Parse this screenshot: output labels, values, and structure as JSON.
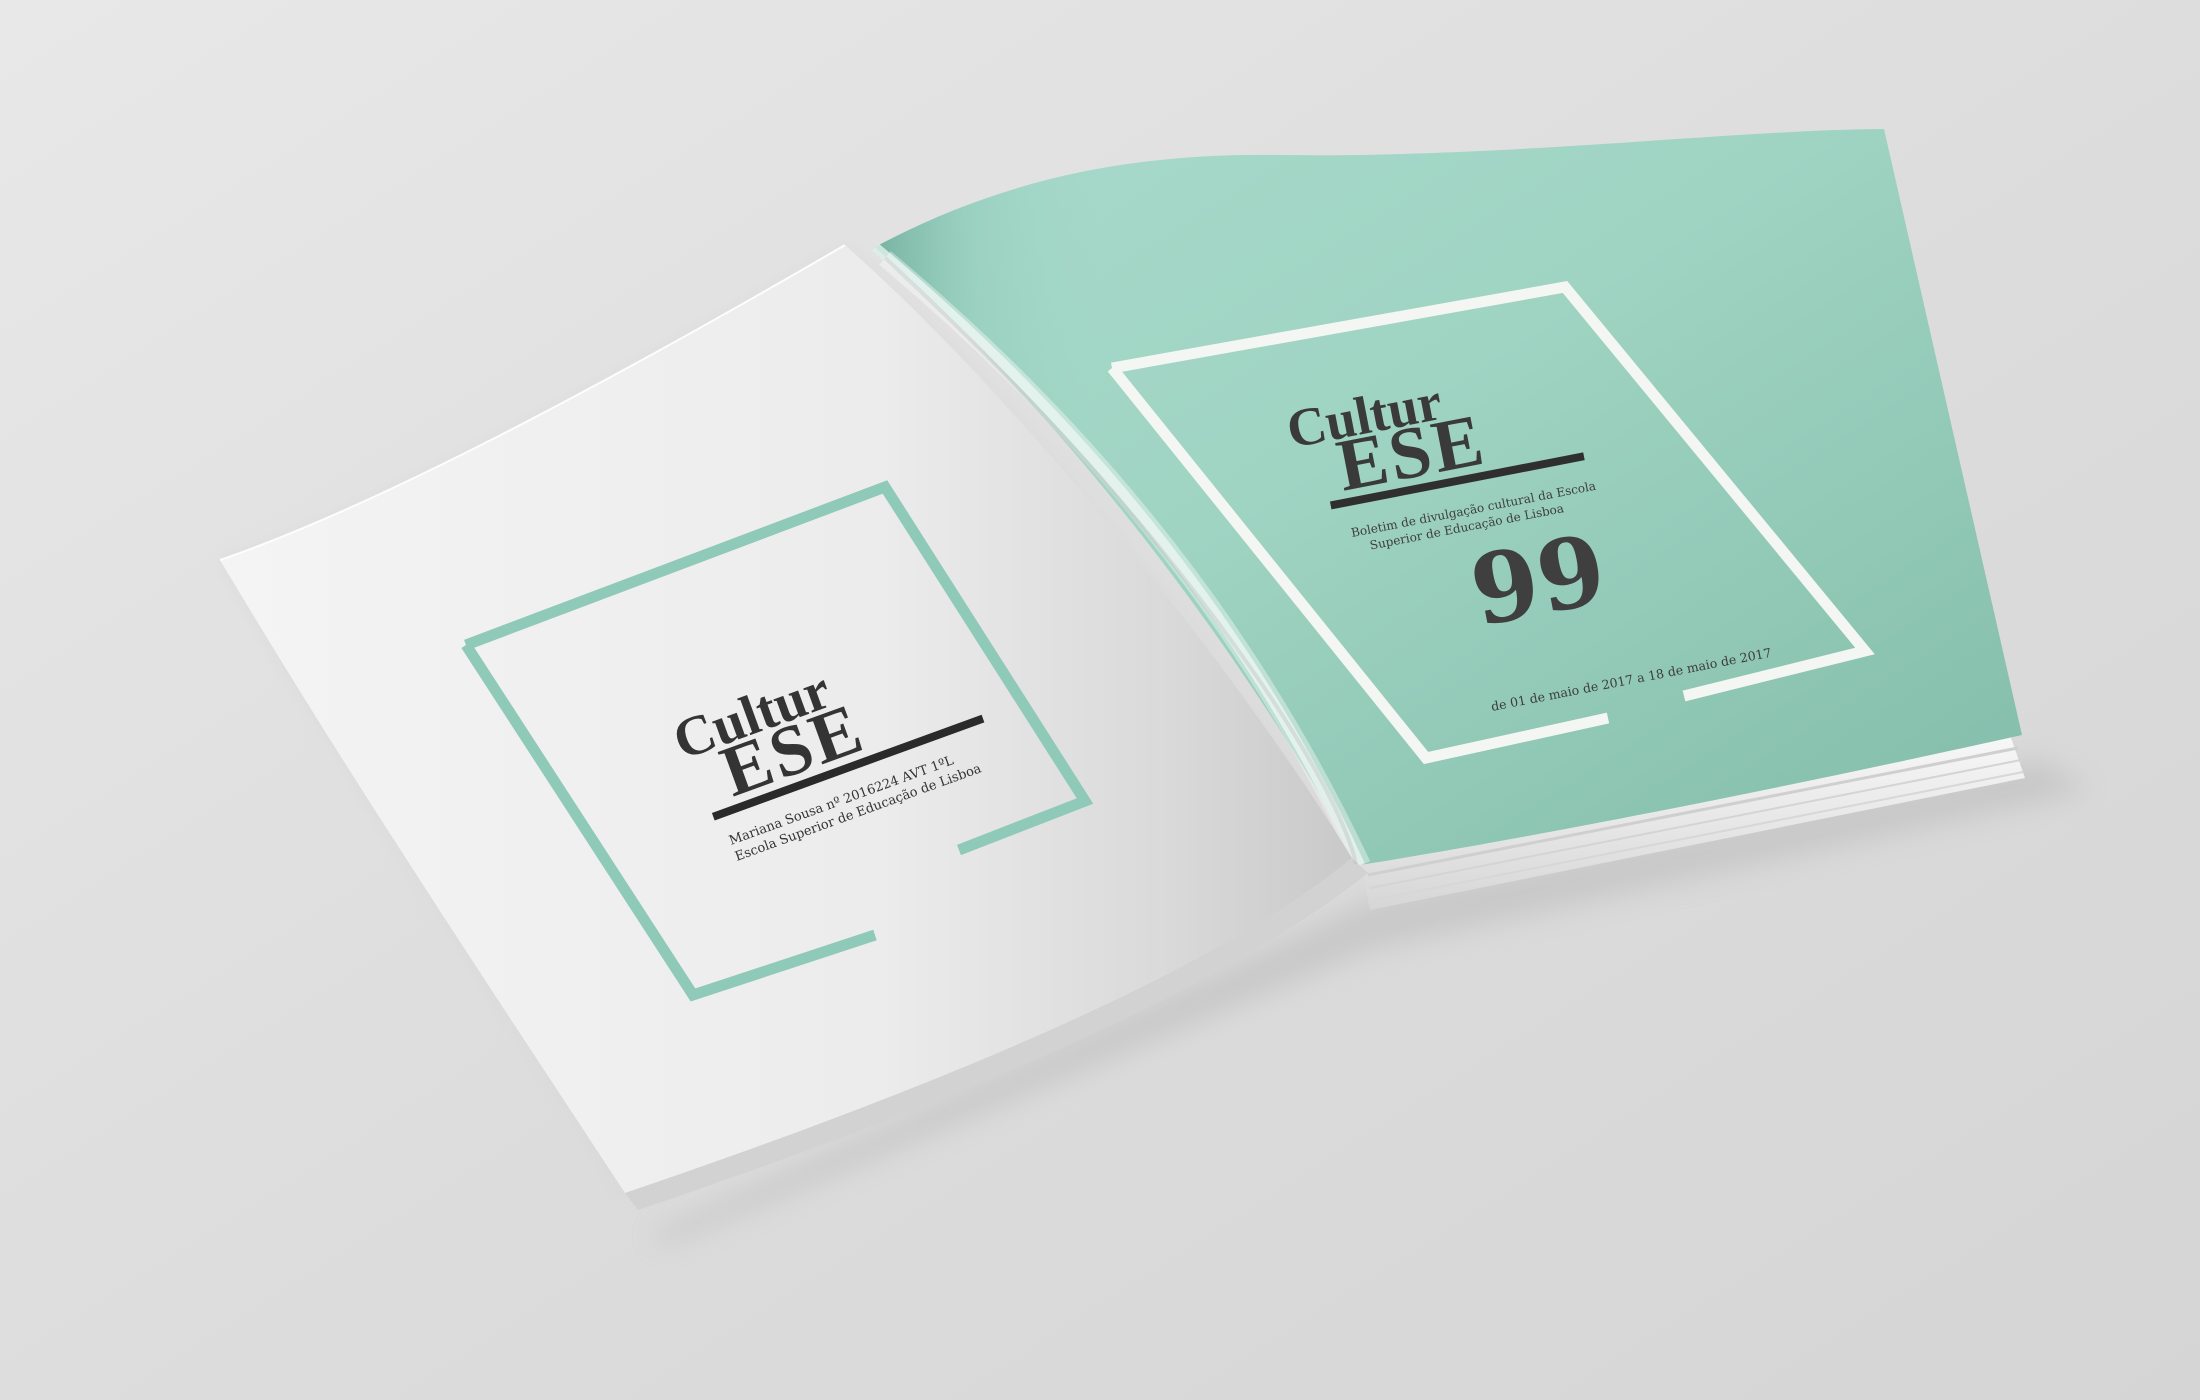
{
  "left_page": {
    "logo": {
      "line1": "Cultur",
      "line2": "ESE"
    },
    "caption": {
      "line1": "Mariana Sousa nº 2016224 AVT 1ºL",
      "line2": "Escola Superior de Educação de Lisboa"
    },
    "frame_color": "#8bc7b6",
    "paper_color": "#efefef"
  },
  "right_page": {
    "logo": {
      "line1": "Cultur",
      "line2": "ESE"
    },
    "subtitle": {
      "line1": "Boletim de divulgação cultural da Escola",
      "line2": "Superior de Educação de Lisboa"
    },
    "issue_number": "99",
    "date_range": "de 01 de maio de 2017 a 18 de maio de 2017",
    "cover_color": "#9fd4c3",
    "frame_color": "#f3f6f3",
    "text_color": "#333333"
  }
}
